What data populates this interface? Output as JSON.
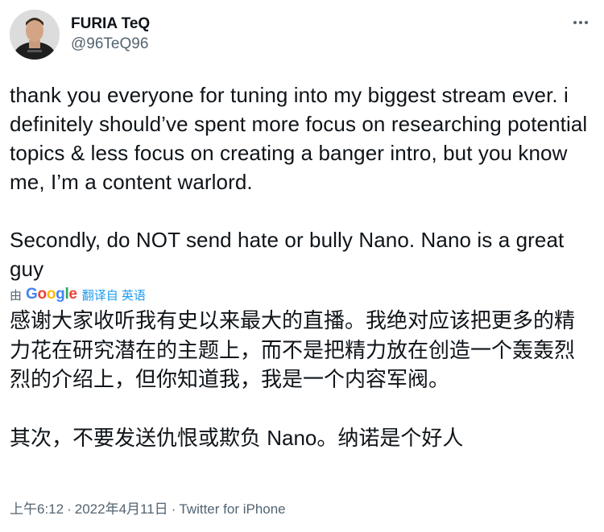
{
  "author": {
    "display_name": "FURIA TeQ",
    "handle": "@96TeQ96",
    "avatar_icon": "user-avatar"
  },
  "more_icon": "more-horizontal-icon",
  "tweet": {
    "text": "thank you everyone for tuning into my biggest stream ever. i definitely should’ve spent more focus on researching potential topics & less focus on creating a banger intro, but you know me, I’m a content warlord.\n\nSecondly, do NOT send hate or bully Nano. Nano is a great guy"
  },
  "translation": {
    "by_label": "由",
    "provider": "Google",
    "source_label": "翻译自 英语",
    "text": "感谢大家收听我有史以来最大的直播。我绝对应该把更多的精力花在研究潜在的主题上，而不是把精力放在创造一个轰轰烈烈的介绍上，但你知道我，我是一个内容军阀。\n\n其次，不要发送仇恨或欺负 Nano。纳诺是个好人"
  },
  "meta": {
    "time": "上午6:12",
    "separator": "·",
    "date": "2022年4月11日",
    "source": "Twitter for iPhone"
  },
  "colors": {
    "text": "#0f1419",
    "secondary": "#536471",
    "link": "#1d9bf0"
  }
}
